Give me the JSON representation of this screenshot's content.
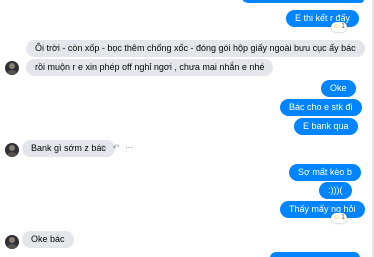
{
  "conversation": {
    "messages": [
      {
        "side": "out",
        "text": "E thi kết r đấy",
        "reaction": "☺",
        "reaction_count": "1"
      },
      {
        "side": "in",
        "text": "Ôi trời - còn xốp - bọc thêm chống xốc - đóng gói hộp giấy ngoài bưu cục ấy bác"
      },
      {
        "side": "in",
        "text": "rồi muộn r e xin phép off nghỉ ngơi , chưa mai nhắn e nhé"
      },
      {
        "side": "out",
        "text": "Oke"
      },
      {
        "side": "out",
        "text": "Bác cho e stk đi"
      },
      {
        "side": "out",
        "text": "E bank qua"
      },
      {
        "side": "in",
        "text": "Bank gì sớm z bác"
      },
      {
        "side": "out",
        "text": "Sợ mất kèo b"
      },
      {
        "side": "out",
        "text": ":)))("
      },
      {
        "side": "out",
        "text": "Thấy mấy ng hỏi",
        "reaction": "☺",
        "reaction_count": "1"
      },
      {
        "side": "in",
        "text": "Oke bác"
      }
    ]
  },
  "tools": {
    "emoji_icon": "☺",
    "reply_icon": "↶",
    "more_icon": "⋯"
  },
  "colors": {
    "outgoing_bubble": "#0084ff",
    "incoming_bubble": "#e4e6eb"
  }
}
